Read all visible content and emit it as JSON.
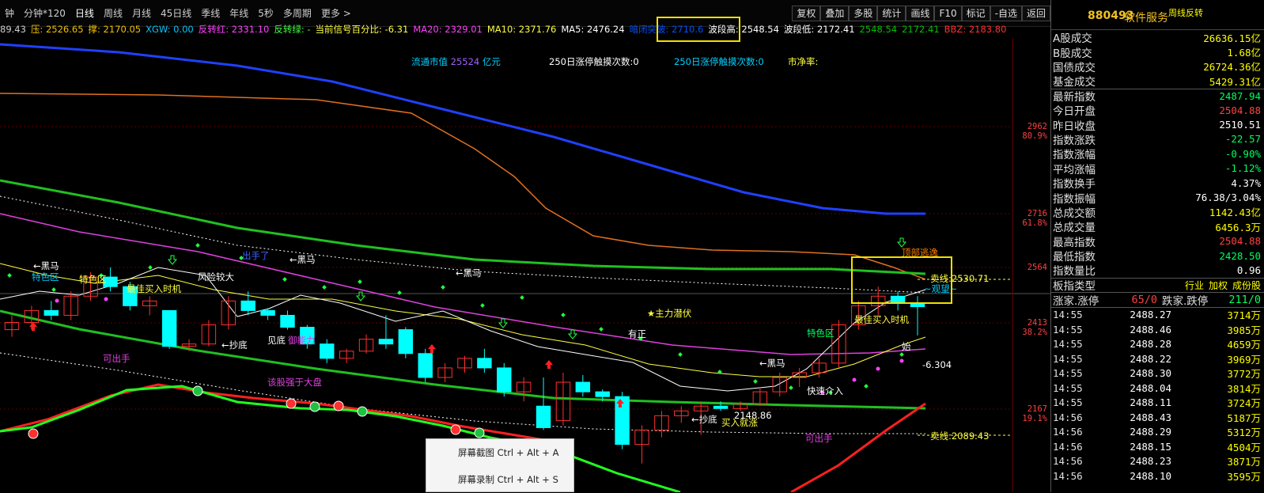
{
  "toolbar": {
    "periods": [
      "钟",
      "分钟*120",
      "日线",
      "周线",
      "月线",
      "45日线",
      "季线",
      "年线",
      "5秒",
      "多周期",
      "更多 >"
    ],
    "active_period": "日线",
    "right_buttons": [
      "复权",
      "叠加",
      "多股",
      "统计",
      "画线",
      "F10",
      "标记",
      "-自选",
      "返回"
    ]
  },
  "indicators": [
    {
      "text": "89.43",
      "color": "#cfcfcf"
    },
    {
      "text": "压: 2526.65",
      "color": "#f0c000"
    },
    {
      "text": "撑: 2170.05",
      "color": "#f0c000"
    },
    {
      "text": "XGW: 0.00",
      "color": "#00c8ff"
    },
    {
      "text": "反转红: 2331.10",
      "color": "#ff40ff"
    },
    {
      "text": "反转绿: -",
      "color": "#40ff40"
    },
    {
      "text": "当前信号百分比: -6.31",
      "color": "#ffff40"
    },
    {
      "text": "MA20: 2329.01",
      "color": "#ff40ff"
    },
    {
      "text": "MA10: 2371.76",
      "color": "#ffff40"
    },
    {
      "text": "MA5: 2476.24",
      "color": "#ffffff"
    },
    {
      "text": "暗闭突破: 2710.6",
      "color": "#0050ff"
    },
    {
      "text": "波段高: 2548.54",
      "color": "#ffffff"
    },
    {
      "text": "波段低: 2172.41",
      "color": "#ffffff"
    },
    {
      "text": "2548.54",
      "color": "#00c000"
    },
    {
      "text": "2172.41",
      "color": "#00c000"
    },
    {
      "text": "BBZ: 2183.80",
      "color": "#ff3030"
    }
  ],
  "chart_info": {
    "market_value_label": "流通市值",
    "market_value": "25524",
    "market_value_unit": "亿元",
    "limit_up_250": "250日涨停触摸次数:0",
    "limit_up_250_b": "250日涨停触摸次数:0",
    "pb_label": "市净率:"
  },
  "price_axis": [
    {
      "value": "2962",
      "pct": "80.9%",
      "y": 112
    },
    {
      "value": "2716",
      "pct": "61.8%",
      "y": 222
    },
    {
      "value": "2564",
      "pct": "",
      "y": 290
    },
    {
      "value": "2413",
      "pct": "38.2%",
      "y": 360
    },
    {
      "value": "2167",
      "pct": "19.1%",
      "y": 469
    }
  ],
  "annotations": {
    "black_horse": "←黑马",
    "special_zone": "特色区",
    "best_buy": "最佳买入时机",
    "risk_big": "风险较大",
    "bottom_fish": "←抄底",
    "see_bottom": "见底",
    "defensive": "御能力",
    "can_sell": "可出手",
    "stronger": "该股强于大盘",
    "main_force": "★主力潜伏",
    "has_profit": "有正",
    "fast_enter": "快速介入",
    "buy_sure": "买入就涨",
    "low_price": "2148.86",
    "top_escape": "顶部逃逸",
    "sell_line": "卖线:2530.71",
    "sell_line2": "卖线:2089.43",
    "signal": "-6.304",
    "start": "始",
    "wait": "~观望~",
    "hands": "出手了"
  },
  "side": {
    "code": "880493",
    "name": "软件服务",
    "tag": "周线反转",
    "stats": [
      {
        "k": "A股成交",
        "v": "26636.15亿",
        "c": "#ffff00"
      },
      {
        "k": "B股成交",
        "v": "1.68亿",
        "c": "#ffff00"
      },
      {
        "k": "国债成交",
        "v": "26724.36亿",
        "c": "#ffff00"
      },
      {
        "k": "基金成交",
        "v": "5429.31亿",
        "c": "#ffff00"
      },
      {
        "k": "最新指数",
        "v": "2487.94",
        "c": "#00ff60",
        "sep": true
      },
      {
        "k": "今日开盘",
        "v": "2504.88",
        "c": "#ff4040"
      },
      {
        "k": "昨日收盘",
        "v": "2510.51",
        "c": "#ffffff"
      },
      {
        "k": "指数涨跌",
        "v": "-22.57",
        "c": "#00ff60"
      },
      {
        "k": "指数涨幅",
        "v": "-0.90%",
        "c": "#00ff60"
      },
      {
        "k": "平均涨幅",
        "v": "-1.12%",
        "c": "#00ff60"
      },
      {
        "k": "指数换手",
        "v": "4.37%",
        "c": "#ffffff"
      },
      {
        "k": "指数振幅",
        "v": "76.38/3.04%",
        "c": "#ffffff"
      },
      {
        "k": "总成交额",
        "v": "1142.43亿",
        "c": "#ffff00"
      },
      {
        "k": "总成交量",
        "v": "6456.3万",
        "c": "#ffff00"
      },
      {
        "k": "最高指数",
        "v": "2504.88",
        "c": "#ff4040"
      },
      {
        "k": "最低指数",
        "v": "2428.50",
        "c": "#00ff60"
      },
      {
        "k": "指数量比",
        "v": "0.96",
        "c": "#ffffff"
      }
    ],
    "board_type_label": "板指类型",
    "board_opts": [
      "行业",
      "加权",
      "成份股"
    ],
    "updown": {
      "up_label": "涨家.涨停",
      "up_val": "65/0",
      "down_label": "跌家.跌停",
      "down_val": "211/0"
    },
    "ticks": [
      {
        "t": "14:55",
        "p": "2488.27",
        "q": "3714万"
      },
      {
        "t": "14:55",
        "p": "2488.46",
        "q": "3985万"
      },
      {
        "t": "14:55",
        "p": "2488.28",
        "q": "4659万"
      },
      {
        "t": "14:55",
        "p": "2488.22",
        "q": "3969万"
      },
      {
        "t": "14:55",
        "p": "2488.30",
        "q": "3772万"
      },
      {
        "t": "14:55",
        "p": "2488.04",
        "q": "3814万"
      },
      {
        "t": "14:55",
        "p": "2488.11",
        "q": "3724万"
      },
      {
        "t": "14:56",
        "p": "2488.43",
        "q": "5187万"
      },
      {
        "t": "14:56",
        "p": "2488.29",
        "q": "5312万"
      },
      {
        "t": "14:56",
        "p": "2488.15",
        "q": "4504万"
      },
      {
        "t": "14:56",
        "p": "2488.23",
        "q": "3871万"
      },
      {
        "t": "14:56",
        "p": "2488.10",
        "q": "3595万"
      }
    ]
  },
  "popup": {
    "items": [
      "屏幕截图 Ctrl + Alt + A",
      "屏幕录制 Ctrl + Alt + S"
    ]
  },
  "colors": {
    "bull": "#ff3030",
    "bear": "#00ffff",
    "ma_blue": "#2040ff",
    "ma_green": "#20c020",
    "ma_orange": "#e07020",
    "ma_magenta": "#e040e0"
  },
  "chart_data": {
    "type": "candlestick",
    "ylim": [
      2100,
      3050
    ],
    "candles": [
      {
        "o": 2440,
        "h": 2470,
        "l": 2425,
        "c": 2455
      },
      {
        "o": 2455,
        "h": 2490,
        "l": 2440,
        "c": 2480
      },
      {
        "o": 2480,
        "h": 2500,
        "l": 2460,
        "c": 2470
      },
      {
        "o": 2470,
        "h": 2520,
        "l": 2460,
        "c": 2510
      },
      {
        "o": 2510,
        "h": 2560,
        "l": 2500,
        "c": 2550
      },
      {
        "o": 2550,
        "h": 2570,
        "l": 2520,
        "c": 2530
      },
      {
        "o": 2530,
        "h": 2540,
        "l": 2480,
        "c": 2490
      },
      {
        "o": 2490,
        "h": 2510,
        "l": 2470,
        "c": 2500
      },
      {
        "o": 2480,
        "h": 2480,
        "l": 2400,
        "c": 2405
      },
      {
        "o": 2405,
        "h": 2420,
        "l": 2395,
        "c": 2410
      },
      {
        "o": 2410,
        "h": 2460,
        "l": 2405,
        "c": 2450
      },
      {
        "o": 2450,
        "h": 2510,
        "l": 2440,
        "c": 2500
      },
      {
        "o": 2500,
        "h": 2520,
        "l": 2470,
        "c": 2480
      },
      {
        "o": 2480,
        "h": 2485,
        "l": 2460,
        "c": 2470
      },
      {
        "o": 2470,
        "h": 2480,
        "l": 2440,
        "c": 2445
      },
      {
        "o": 2445,
        "h": 2450,
        "l": 2400,
        "c": 2410
      },
      {
        "o": 2410,
        "h": 2420,
        "l": 2370,
        "c": 2380
      },
      {
        "o": 2380,
        "h": 2400,
        "l": 2370,
        "c": 2395
      },
      {
        "o": 2395,
        "h": 2430,
        "l": 2390,
        "c": 2420
      },
      {
        "o": 2420,
        "h": 2470,
        "l": 2400,
        "c": 2410
      },
      {
        "o": 2440,
        "h": 2445,
        "l": 2380,
        "c": 2390
      },
      {
        "o": 2390,
        "h": 2400,
        "l": 2330,
        "c": 2340
      },
      {
        "o": 2340,
        "h": 2370,
        "l": 2330,
        "c": 2360
      },
      {
        "o": 2360,
        "h": 2385,
        "l": 2350,
        "c": 2380
      },
      {
        "o": 2380,
        "h": 2400,
        "l": 2350,
        "c": 2360
      },
      {
        "o": 2360,
        "h": 2370,
        "l": 2300,
        "c": 2310
      },
      {
        "o": 2310,
        "h": 2340,
        "l": 2290,
        "c": 2330
      },
      {
        "o": 2280,
        "h": 2340,
        "l": 2230,
        "c": 2235
      },
      {
        "o": 2250,
        "h": 2350,
        "l": 2240,
        "c": 2330
      },
      {
        "o": 2330,
        "h": 2345,
        "l": 2300,
        "c": 2310
      },
      {
        "o": 2310,
        "h": 2315,
        "l": 2290,
        "c": 2300
      },
      {
        "o": 2300,
        "h": 2310,
        "l": 2190,
        "c": 2200
      },
      {
        "o": 2200,
        "h": 2240,
        "l": 2160,
        "c": 2230
      },
      {
        "o": 2230,
        "h": 2270,
        "l": 2215,
        "c": 2260
      },
      {
        "o": 2260,
        "h": 2280,
        "l": 2245,
        "c": 2270
      },
      {
        "o": 2270,
        "h": 2290,
        "l": 2220,
        "c": 2280
      },
      {
        "o": 2280,
        "h": 2290,
        "l": 2270,
        "c": 2275
      },
      {
        "o": 2275,
        "h": 2290,
        "l": 2270,
        "c": 2285
      },
      {
        "o": 2285,
        "h": 2320,
        "l": 2280,
        "c": 2310
      },
      {
        "o": 2310,
        "h": 2350,
        "l": 2300,
        "c": 2340
      },
      {
        "o": 2340,
        "h": 2360,
        "l": 2320,
        "c": 2350
      },
      {
        "o": 2350,
        "h": 2380,
        "l": 2340,
        "c": 2370
      },
      {
        "o": 2370,
        "h": 2460,
        "l": 2360,
        "c": 2450
      },
      {
        "o": 2450,
        "h": 2500,
        "l": 2440,
        "c": 2490
      },
      {
        "o": 2490,
        "h": 2530,
        "l": 2470,
        "c": 2510
      },
      {
        "o": 2510,
        "h": 2520,
        "l": 2480,
        "c": 2495
      },
      {
        "o": 2495,
        "h": 2510,
        "l": 2428,
        "c": 2488
      }
    ]
  }
}
